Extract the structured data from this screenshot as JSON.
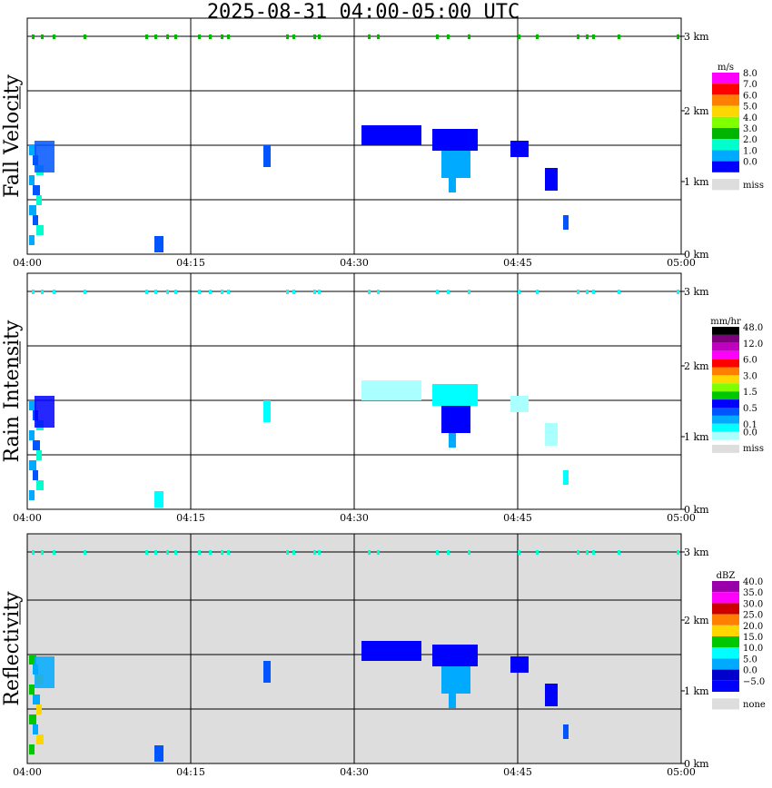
{
  "title": "2025-08-31   04:00-05:00 UTC",
  "chart_data": [
    {
      "type": "heatmap",
      "panel": "Fall Velocity",
      "unit": "m/s",
      "x_ticks": [
        "04:00",
        "04:15",
        "04:30",
        "04:45",
        "05:00"
      ],
      "y_ticks": [
        "0 km",
        "1 km",
        "2 km",
        "3 km"
      ],
      "ylim_km": [
        0,
        3.2
      ],
      "background": "#ffffff",
      "colorbar": [
        {
          "label": "8.0",
          "color": "#ff00ff"
        },
        {
          "label": "7.0",
          "color": "#ff0000"
        },
        {
          "label": "6.0",
          "color": "#ff7f00"
        },
        {
          "label": "5.0",
          "color": "#ffd700"
        },
        {
          "label": "4.0",
          "color": "#7fff00"
        },
        {
          "label": "3.0",
          "color": "#00b400"
        },
        {
          "label": "2.0",
          "color": "#00ffcc"
        },
        {
          "label": "1.0",
          "color": "#00aaff"
        },
        {
          "label": "0.0",
          "color": "#0000ff"
        },
        {
          "label": "miss",
          "color": "#dddddd"
        }
      ]
    },
    {
      "type": "heatmap",
      "panel": "Rain Intensity",
      "unit": "mm/hr",
      "x_ticks": [
        "04:00",
        "04:15",
        "04:30",
        "04:45",
        "05:00"
      ],
      "y_ticks": [
        "0 km",
        "1 km",
        "2 km",
        "3 km"
      ],
      "ylim_km": [
        0,
        3.2
      ],
      "background": "#ffffff",
      "colorbar": [
        {
          "label": "48.0",
          "color": "#000000"
        },
        {
          "label": "",
          "color": "#7f007f"
        },
        {
          "label": "12.0",
          "color": "#bf00bf"
        },
        {
          "label": "",
          "color": "#ff00ff"
        },
        {
          "label": "6.0",
          "color": "#ff0000"
        },
        {
          "label": "",
          "color": "#ff7f00"
        },
        {
          "label": "3.0",
          "color": "#ffd700"
        },
        {
          "label": "",
          "color": "#7fff00"
        },
        {
          "label": "1.5",
          "color": "#00c800"
        },
        {
          "label": "",
          "color": "#0000ff"
        },
        {
          "label": "0.5",
          "color": "#0055ff"
        },
        {
          "label": "",
          "color": "#00aaff"
        },
        {
          "label": "0.1",
          "color": "#00ffff"
        },
        {
          "label": "0.0",
          "color": "#aaffff"
        },
        {
          "label": "miss",
          "color": "#dddddd"
        }
      ]
    },
    {
      "type": "heatmap",
      "panel": "Reflectivity",
      "unit": "dBZ",
      "x_ticks": [
        "04:00",
        "04:15",
        "04:30",
        "04:45",
        "05:00"
      ],
      "y_ticks": [
        "0 km",
        "1 km",
        "2 km",
        "3 km"
      ],
      "ylim_km": [
        0,
        3.2
      ],
      "background": "#dddddd",
      "colorbar": [
        {
          "label": "40.0",
          "color": "#9900aa"
        },
        {
          "label": "35.0",
          "color": "#ff00ff"
        },
        {
          "label": "30.0",
          "color": "#cc0000"
        },
        {
          "label": "25.0",
          "color": "#ff7f00"
        },
        {
          "label": "20.0",
          "color": "#ffd700"
        },
        {
          "label": "15.0",
          "color": "#00c800"
        },
        {
          "label": "10.0",
          "color": "#00ffff"
        },
        {
          "label": "5.0",
          "color": "#00aaff"
        },
        {
          "label": "0.0",
          "color": "#0000cc"
        },
        {
          "label": "−5.0",
          "color": "#0000ff"
        },
        {
          "label": "none",
          "color": "#dddddd"
        }
      ]
    }
  ]
}
